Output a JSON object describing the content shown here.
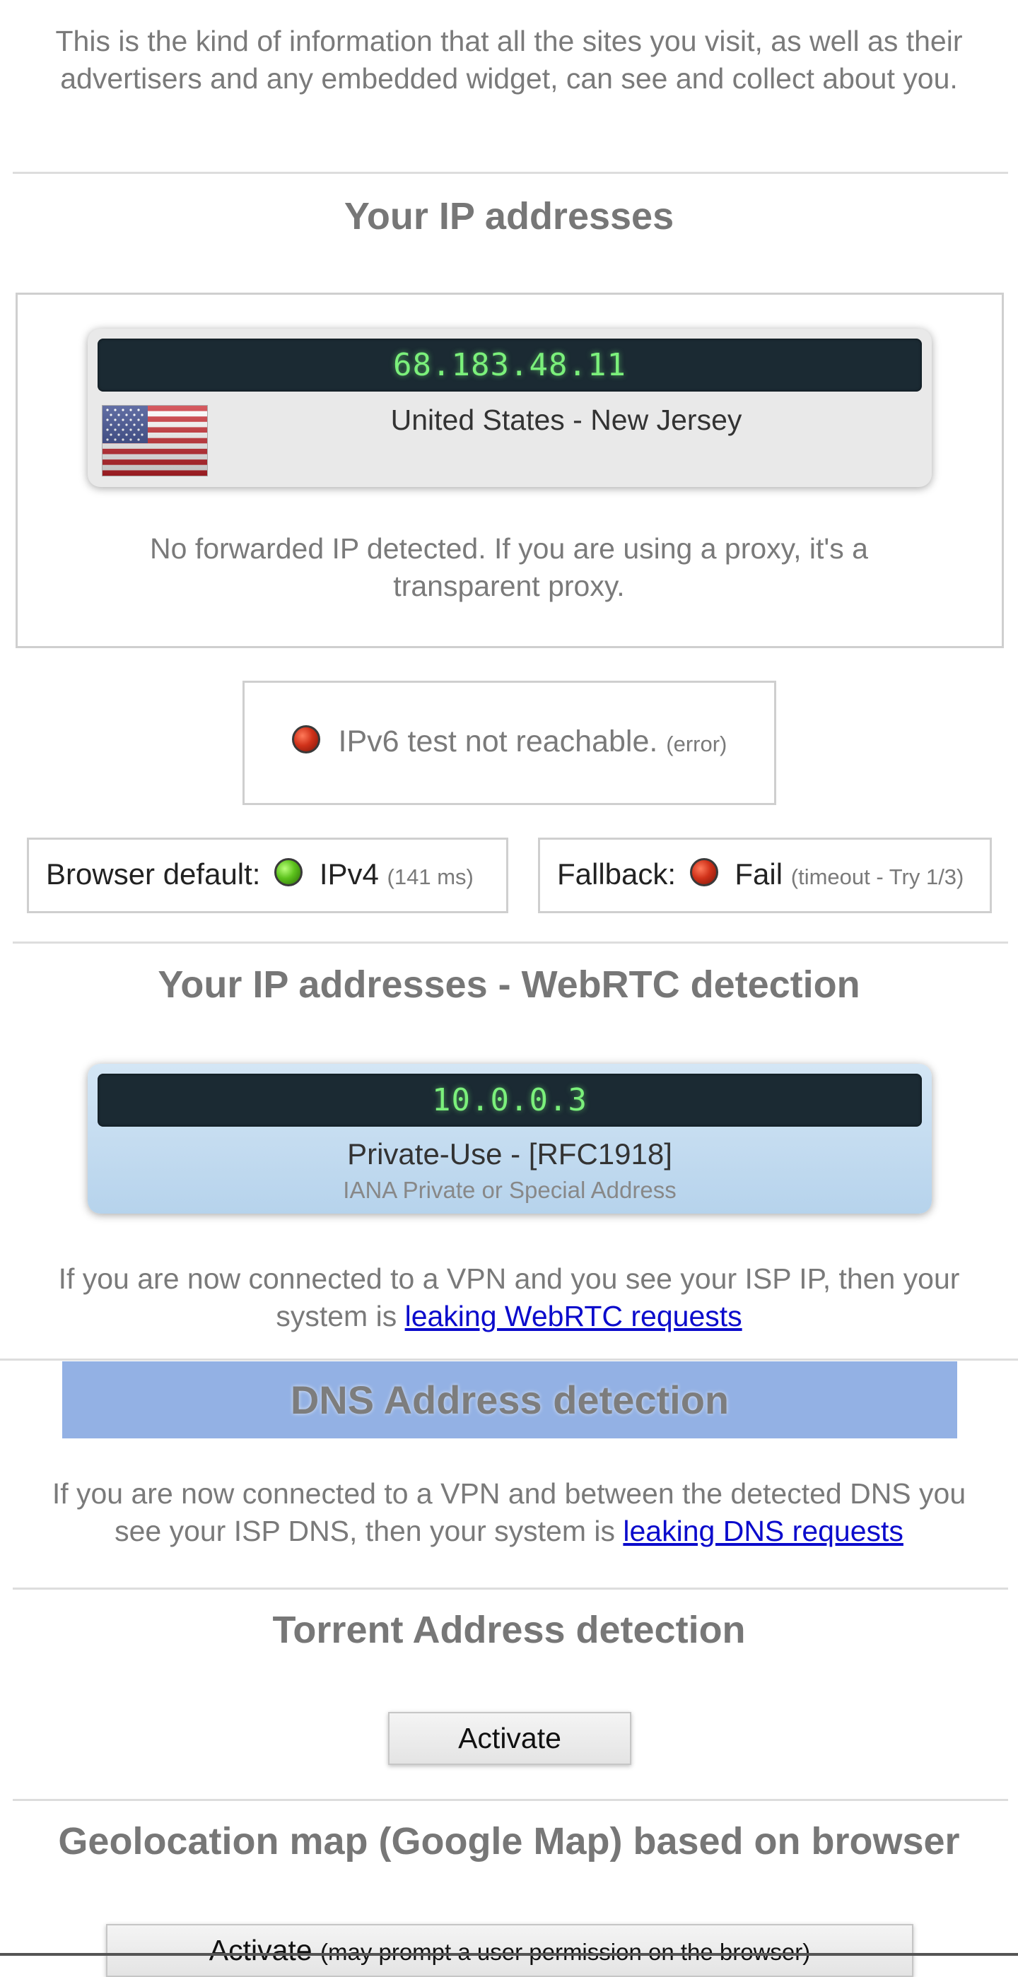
{
  "intro": {
    "text": "This is the kind of information that all the sites you visit, as well as their advertisers and any embedded widget, can see and collect about you."
  },
  "ip_section": {
    "title": "Your IP addresses",
    "ip": "68.183.48.11",
    "location": "United States - New Jersey",
    "flag_icon": "us-flag-icon",
    "forwarded_note": "No forwarded IP detected. If you are using a proxy, it's a transparent proxy."
  },
  "ipv6_test": {
    "text": "IPv6 test not reachable.",
    "status": "(error)",
    "status_color": "red"
  },
  "browser_default": {
    "label": "Browser default:",
    "value": "IPv4",
    "detail": "(141 ms)",
    "status_color": "green"
  },
  "fallback": {
    "label": "Fallback:",
    "value": "Fail",
    "detail": "(timeout - Try 1/3)",
    "status_color": "red"
  },
  "webrtc_section": {
    "title": "Your IP addresses - WebRTC detection",
    "ip": "10.0.0.3",
    "label": "Private-Use - [RFC1918]",
    "sublabel": "IANA Private or Special Address",
    "note_prefix": "If you are now connected to a VPN and you see your ISP IP, then your system is ",
    "note_link": "leaking WebRTC requests"
  },
  "dns_section": {
    "title": "DNS Address detection",
    "header_bg": "#93b1e4",
    "note_prefix": "If you are now connected to a VPN and between the detected DNS you see your ISP DNS, then your system is ",
    "note_link": "leaking DNS requests"
  },
  "torrent_section": {
    "title": "Torrent Address detection",
    "button_label": "Activate"
  },
  "geo_section": {
    "title": "Geolocation map (Google Map) based on browser",
    "button_label": "Activate",
    "button_note": "(may prompt a user permission on the browser)"
  },
  "colors": {
    "ip_text": "#7bf07b",
    "ip_bar_bg": "#1b2a33",
    "link": "#0b0bcc"
  }
}
